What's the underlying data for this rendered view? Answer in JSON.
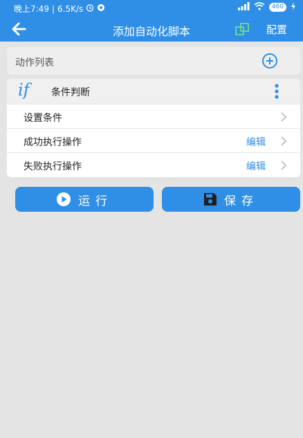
{
  "status_bar": {
    "time": "晚上7:49",
    "speed": "6.5K/s",
    "battery": "460"
  },
  "app_bar": {
    "title": "添加自动化脚本",
    "config_label": "配置"
  },
  "action_list": {
    "header_label": "动作列表"
  },
  "condition_card": {
    "icon_text": "if",
    "title": "条件判断",
    "rows": [
      {
        "label": "设置条件",
        "edit": ""
      },
      {
        "label": "成功执行操作",
        "edit": "编辑"
      },
      {
        "label": "失败执行操作",
        "edit": "编辑"
      }
    ]
  },
  "buttons": {
    "run_label": "运行",
    "save_label": "保存"
  },
  "colors": {
    "primary": "#2f8ee6",
    "background": "#e4e4e4"
  }
}
